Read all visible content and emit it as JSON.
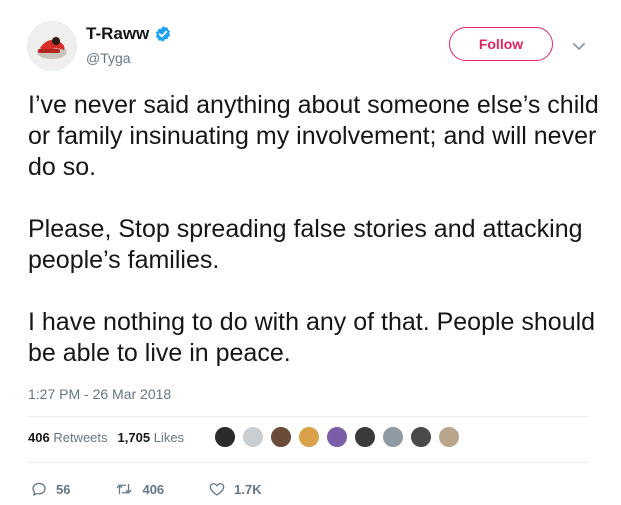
{
  "user": {
    "display_name": "T-Raww",
    "handle": "@Tyga",
    "verified": true,
    "avatar_icon": "profile-avatar"
  },
  "header": {
    "follow_label": "Follow",
    "menu_icon": "chevron-down-icon"
  },
  "tweet": {
    "paragraphs": [
      "I’ve never said anything about someone else’s child or family insinuating my involvement; and will never do so.",
      "Please, Stop spreading false stories and attacking people’s families.",
      "I have nothing to do with any of that. People should be able to live in peace."
    ],
    "timestamp": "1:27 PM - 26 Mar 2018"
  },
  "stats": {
    "retweets_count": "406",
    "retweets_label": "Retweets",
    "likes_count": "1,705",
    "likes_label": "Likes",
    "liker_avatar_colors": [
      "#2b2b2b",
      "#c9ced3",
      "#6b4b3a",
      "#d9a24a",
      "#7a5fa8",
      "#3a3a3a",
      "#8f9aa3",
      "#4a4a4a",
      "#b8a58c"
    ]
  },
  "actions": {
    "replies": "56",
    "retweets": "406",
    "likes": "1.7K"
  },
  "colors": {
    "follow_accent": "#e0245e",
    "verified_blue": "#1da1f2",
    "muted": "#657786"
  }
}
